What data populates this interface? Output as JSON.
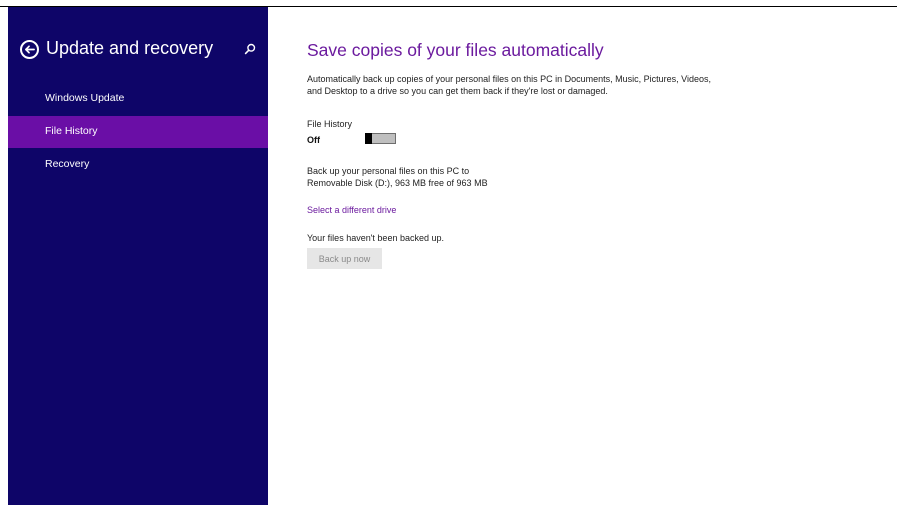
{
  "sidebar": {
    "title": "Update and recovery",
    "items": [
      {
        "label": "Windows Update",
        "selected": false
      },
      {
        "label": "File History",
        "selected": true
      },
      {
        "label": "Recovery",
        "selected": false
      }
    ]
  },
  "main": {
    "title": "Save copies of your files automatically",
    "description": "Automatically back up copies of your personal files on this PC in Documents, Music, Pictures, Videos, and Desktop to a drive so you can get them back if they're lost or damaged.",
    "file_history_label": "File History",
    "toggle_state": "Off",
    "backup_line1": "Back up your personal files on this PC to",
    "backup_line2": "Removable Disk (D:), 963 MB free of 963 MB",
    "select_drive_link": "Select a different drive",
    "status_text": "Your files haven't been backed up.",
    "backup_button": "Back up now"
  },
  "colors": {
    "sidebar_bg": "#0e0568",
    "selected_bg": "#6a0ea6",
    "accent": "#6b1a9e"
  },
  "icons": {
    "back": "back-arrow-icon",
    "search": "search-icon"
  }
}
